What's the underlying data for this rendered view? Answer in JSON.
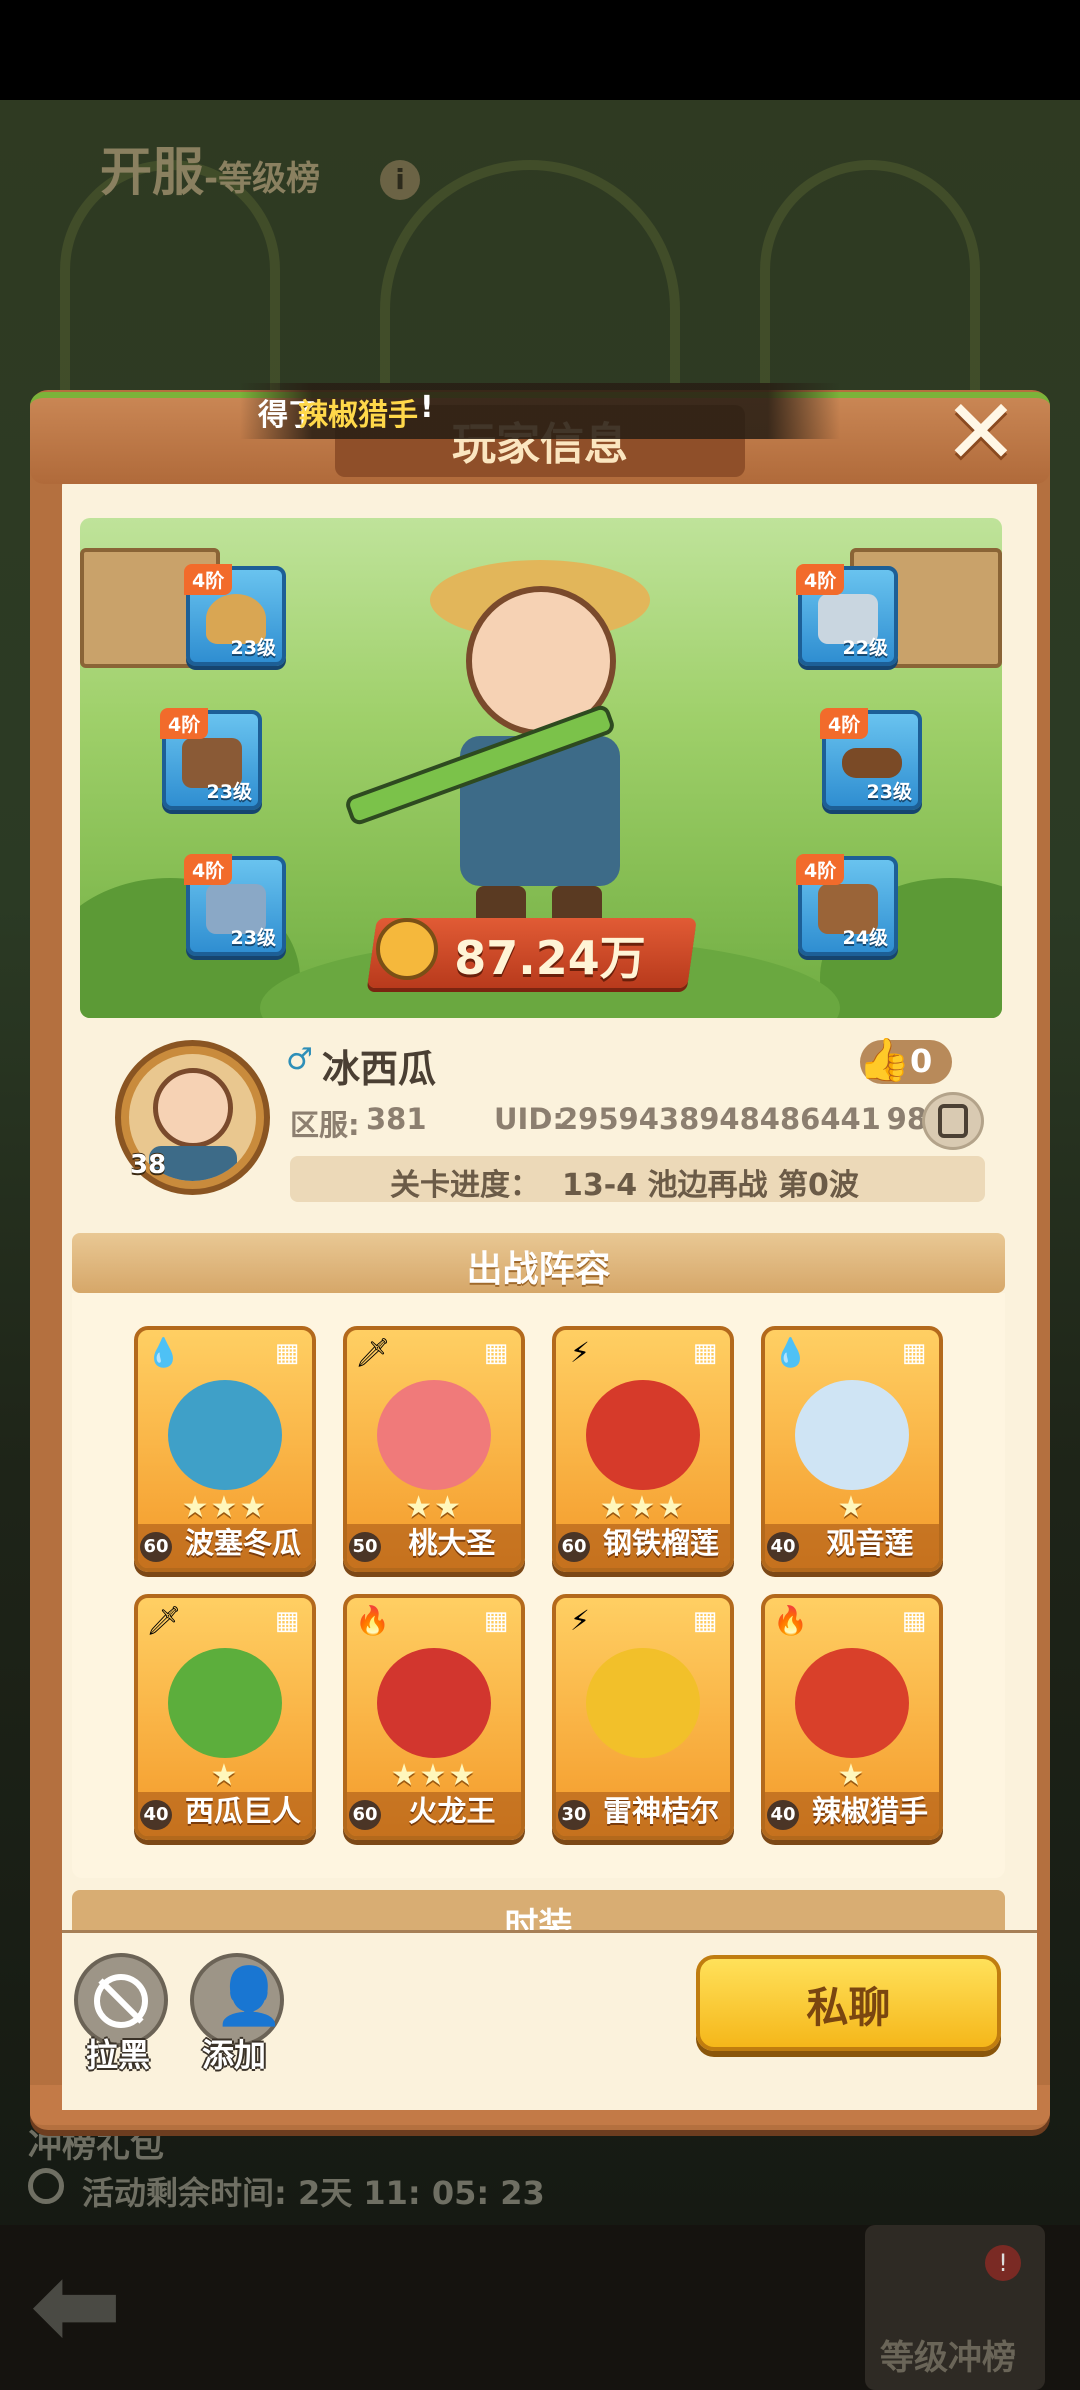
{
  "background": {
    "title": "开服",
    "subtitle": "-等级榜",
    "bottom_title": "冲榜礼包",
    "timer_text": "活动剩余时间: 2天 11: 05: 23",
    "rank_button_label": "等级冲榜",
    "rank_badge": "!"
  },
  "ticker": {
    "prefix": "得了",
    "highlight": "辣椒猎手",
    "suffix": "!"
  },
  "dialog": {
    "title": "玩家信息",
    "close_icon": "close-icon"
  },
  "equipment": [
    {
      "slot": "hat",
      "tier": "4阶",
      "level": "23级"
    },
    {
      "slot": "gloves",
      "tier": "4阶",
      "level": "23级"
    },
    {
      "slot": "pants",
      "tier": "4阶",
      "level": "23级"
    },
    {
      "slot": "shirt",
      "tier": "4阶",
      "level": "22级"
    },
    {
      "slot": "belt",
      "tier": "4阶",
      "level": "23级"
    },
    {
      "slot": "boots",
      "tier": "4阶",
      "level": "24级"
    }
  ],
  "power": {
    "value": "87.24万"
  },
  "player": {
    "level": "38",
    "gender_icon": "male-icon",
    "name": "冰西瓜",
    "likes": "0",
    "server_label": "区服:",
    "server_value": "381",
    "uid_label": "UID:",
    "uid_value": "2959438948486441 98",
    "progress_label": "关卡进度：",
    "progress_value": "13-4  池边再战 第0波"
  },
  "lineup": {
    "title": "出战阵容",
    "cards": [
      {
        "name": "波塞冬瓜",
        "level": "60",
        "stars": "★★★",
        "element": "water",
        "color": "#3fa0c8"
      },
      {
        "name": "桃大圣",
        "level": "50",
        "stars": "★★",
        "element": "sword",
        "color": "#f07a7a"
      },
      {
        "name": "钢铁榴莲",
        "level": "60",
        "stars": "★★★",
        "element": "thunder",
        "color": "#d63a2a"
      },
      {
        "name": "观音莲",
        "level": "40",
        "stars": "★",
        "element": "water",
        "color": "#cfe4f4"
      },
      {
        "name": "西瓜巨人",
        "level": "40",
        "stars": "★",
        "element": "sword",
        "color": "#5cae3c"
      },
      {
        "name": "火龙王",
        "level": "60",
        "stars": "★★★",
        "element": "fire",
        "color": "#d2362e"
      },
      {
        "name": "雷神桔尔",
        "level": "30",
        "stars": "",
        "element": "thunder",
        "color": "#f2c02a"
      },
      {
        "name": "辣椒猎手",
        "level": "40",
        "stars": "★",
        "element": "fire",
        "color": "#d9402a"
      }
    ]
  },
  "costume": {
    "title": "时装"
  },
  "actions": {
    "block_label": "拉黑",
    "add_label": "添加",
    "chat_label": "私聊"
  }
}
